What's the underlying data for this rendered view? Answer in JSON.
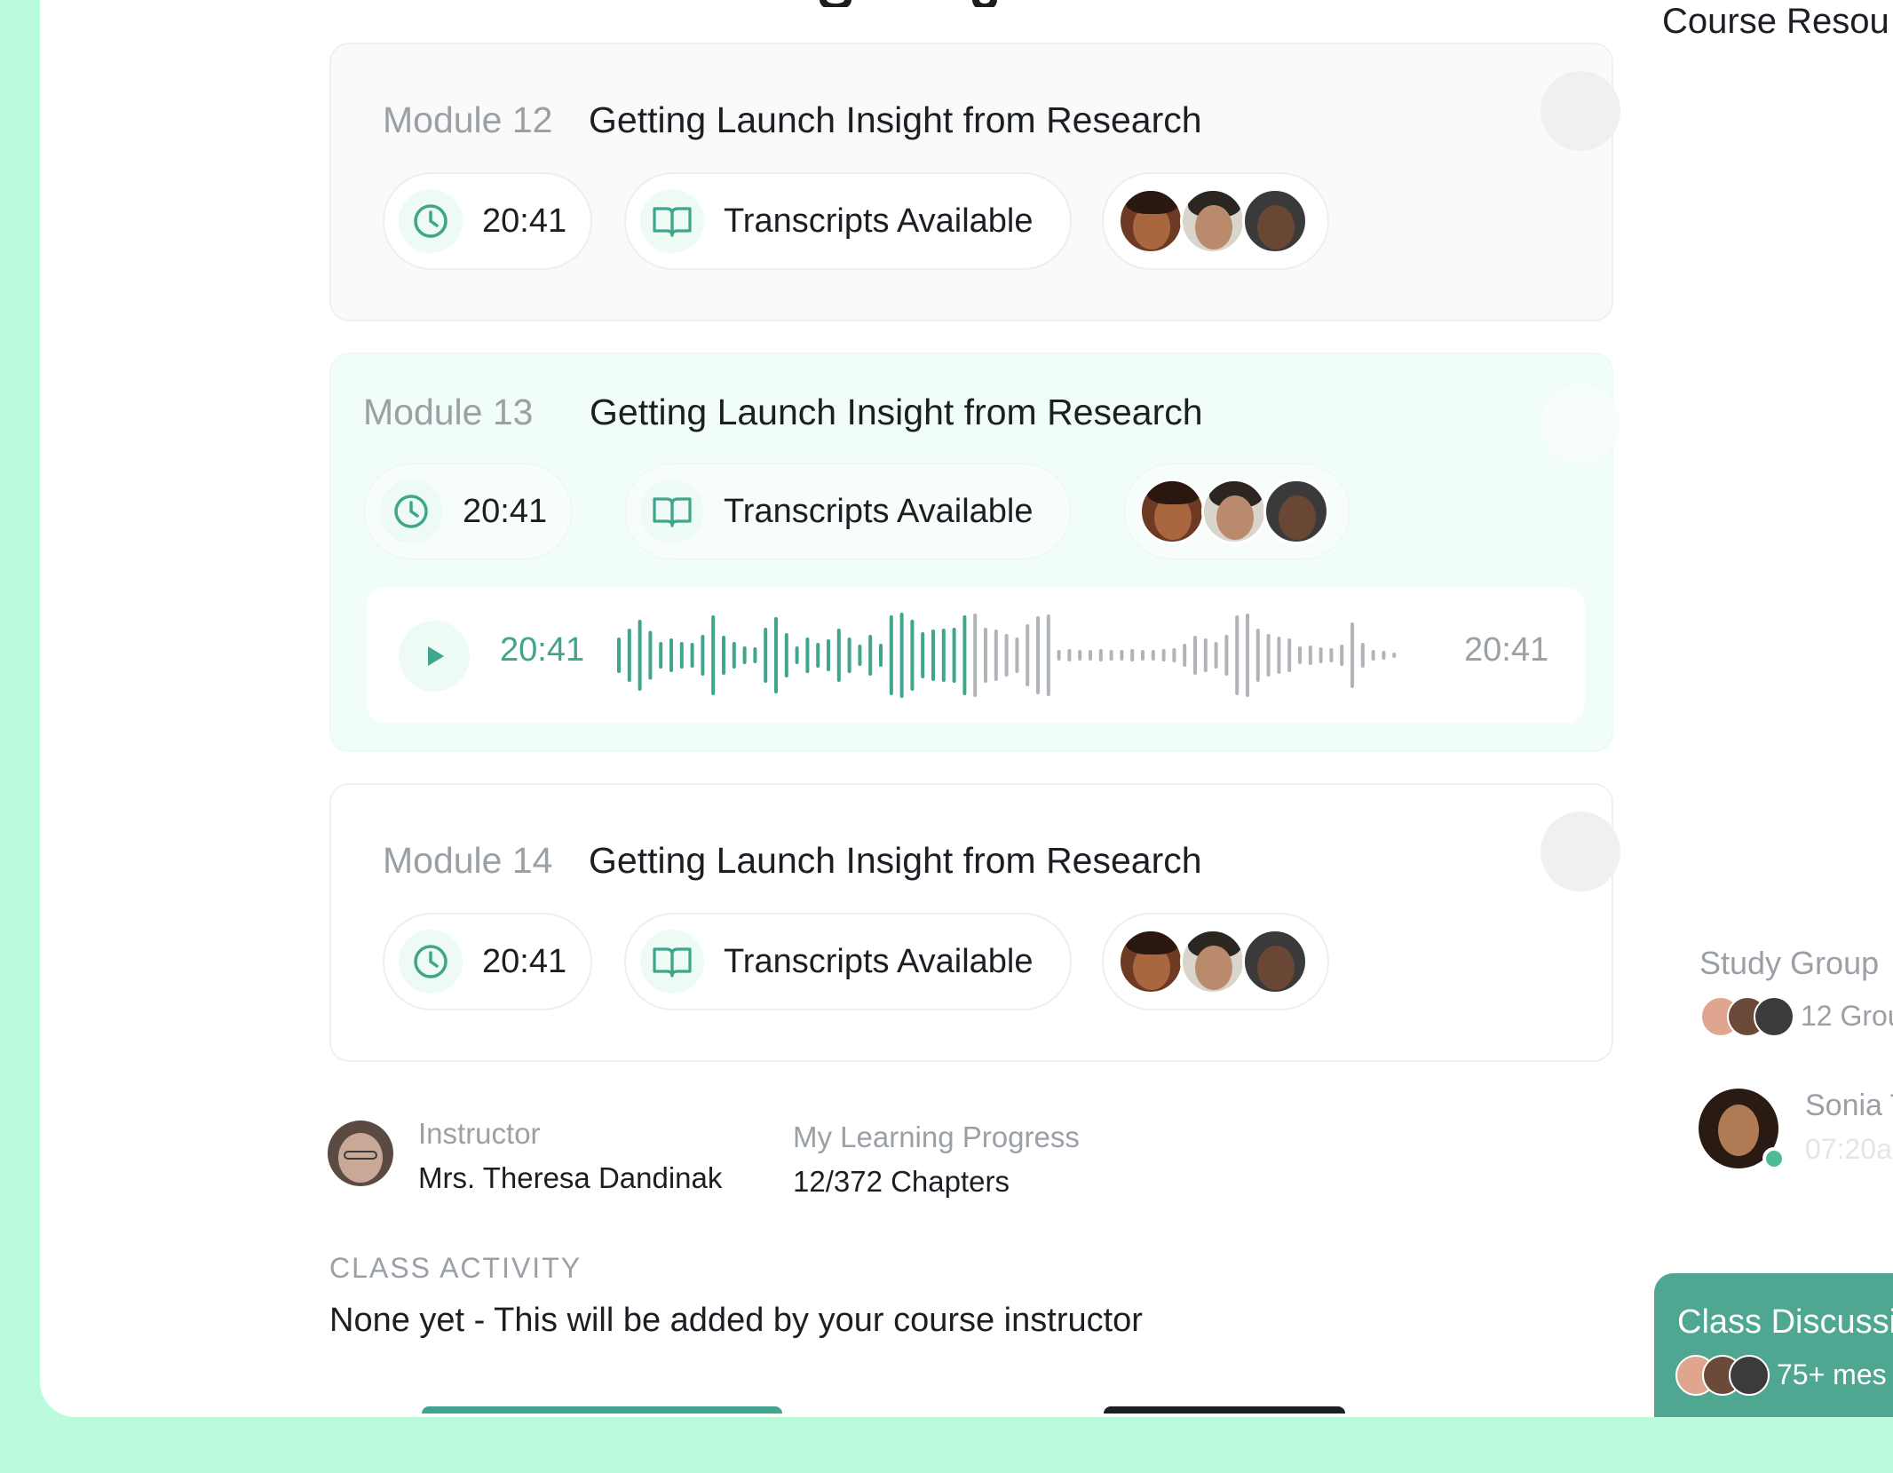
{
  "sidebar": {
    "heading": "Course Resou",
    "study_group": {
      "title": "Study Group",
      "count": "12 Grou"
    },
    "member": {
      "name": "Sonia T",
      "time": "07:20a"
    },
    "discussion": {
      "title": "Class Discussi",
      "messages": "75+ mes"
    }
  },
  "modules": [
    {
      "label": "Module 12",
      "title": "Getting Launch Insight from Research",
      "duration": "20:41",
      "transcripts": "Transcripts Available"
    },
    {
      "label": "Module 13",
      "title": "Getting Launch Insight from Research",
      "duration": "20:41",
      "transcripts": "Transcripts Available",
      "player": {
        "current": "20:41",
        "total": "20:41"
      }
    },
    {
      "label": "Module 14",
      "title": "Getting Launch Insight from Research",
      "duration": "20:41",
      "transcripts": "Transcripts Available"
    }
  ],
  "instructor": {
    "label": "Instructor",
    "name": "Mrs. Theresa Dandinak"
  },
  "progress": {
    "label": "My Learning Progress",
    "value": "12/372 Chapters"
  },
  "activity": {
    "label": "CLASS ACTIVITY",
    "text": "None yet - This will be added by your course instructor"
  },
  "colors": {
    "accent": "#3fa58d",
    "background": "#b9fbda",
    "discussion_card": "#4fa791"
  },
  "icons": [
    "clock-icon",
    "book-icon",
    "play-icon"
  ]
}
